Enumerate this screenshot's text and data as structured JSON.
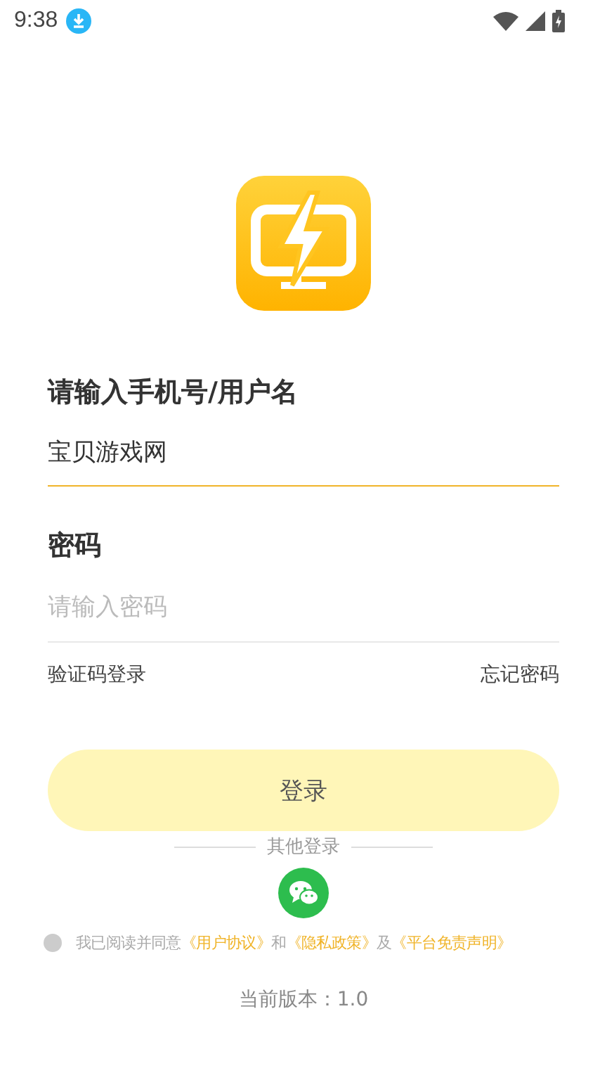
{
  "status_bar": {
    "time": "9:38"
  },
  "account": {
    "label": "请输入手机号/用户名",
    "value": "宝贝游戏网"
  },
  "password": {
    "label": "密码",
    "placeholder": "请输入密码"
  },
  "links": [
    "验证码登录",
    "忘记密码"
  ],
  "login_button": "登录",
  "other_login": "其他登录",
  "agreement": {
    "checked": false,
    "parts": [
      {
        "kind": "plain",
        "text": "我已阅读并同意"
      },
      {
        "kind": "link",
        "text": "《用户协议》"
      },
      {
        "kind": "plain",
        "text": "和"
      },
      {
        "kind": "link",
        "text": "《隐私政策》"
      },
      {
        "kind": "plain",
        "text": "及"
      },
      {
        "kind": "link",
        "text": "《平台免责声明》"
      }
    ]
  },
  "version": "当前版本：1.0"
}
